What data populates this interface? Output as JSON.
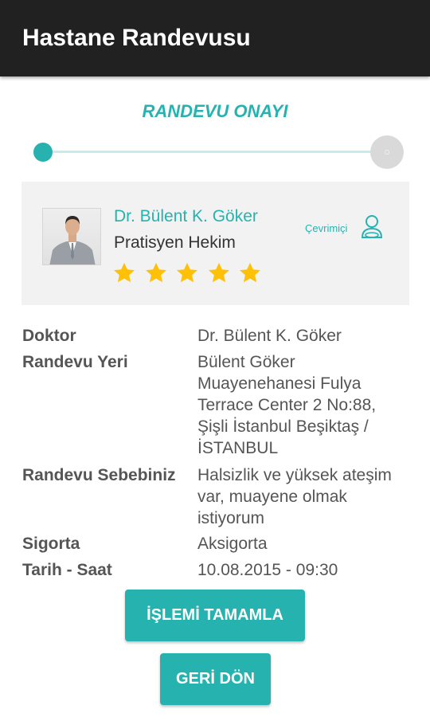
{
  "appbar": {
    "title": "Hastane Randevusu"
  },
  "stepper": {
    "title": "RANDEVU ONAYI",
    "current_step": 1,
    "total_steps": 2
  },
  "doctor_card": {
    "name": "Dr. Bülent K. Göker",
    "specialty": "Pratisyen Hekim",
    "rating": 5,
    "rating_max": 5,
    "status": "Çevrimiçi",
    "status_icon": "user-online-icon",
    "star_color": "#FFC107"
  },
  "details": [
    {
      "label": "Doktor",
      "value": "Dr. Bülent K. Göker"
    },
    {
      "label": "Randevu Yeri",
      "value": "Bülent Göker Muayenehanesi Fulya Terrace Center 2 No:88, Şişli İstanbul Beşiktaş / İSTANBUL"
    },
    {
      "label": "Randevu Sebebiniz",
      "value": "Halsizlik ve yüksek ateşim var, muayene olmak istiyorum"
    },
    {
      "label": "Sigorta",
      "value": "Aksigorta"
    },
    {
      "label": "Tarih - Saat",
      "value": "10.08.2015 - 09:30"
    }
  ],
  "actions": {
    "complete_label": "İŞLEMİ TAMAMLA",
    "back_label": "GERİ DÖN"
  },
  "colors": {
    "accent": "#26B3B0",
    "appbar": "#212121",
    "card_bg": "#F2F2F2"
  }
}
